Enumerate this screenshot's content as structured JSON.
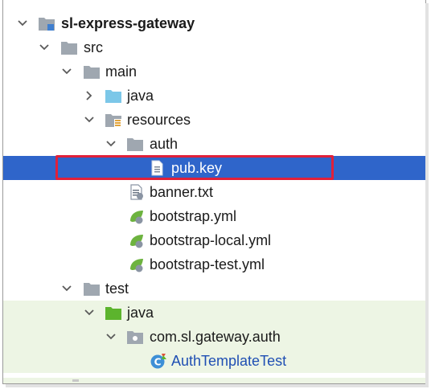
{
  "project_tree": {
    "items": [
      {
        "label": "sl-express-gateway",
        "icon": "module-folder-icon",
        "expanded": true
      },
      {
        "label": "src",
        "icon": "folder-icon",
        "expanded": true
      },
      {
        "label": "main",
        "icon": "folder-icon",
        "expanded": true
      },
      {
        "label": "java",
        "icon": "source-folder-icon",
        "expanded": false
      },
      {
        "label": "resources",
        "icon": "resources-folder-icon",
        "expanded": true
      },
      {
        "label": "auth",
        "icon": "folder-icon",
        "expanded": true
      },
      {
        "label": "pub.key",
        "icon": "text-file-icon",
        "selected": true
      },
      {
        "label": "banner.txt",
        "icon": "text-file-icon"
      },
      {
        "label": "bootstrap.yml",
        "icon": "spring-yml-icon"
      },
      {
        "label": "bootstrap-local.yml",
        "icon": "spring-yml-icon"
      },
      {
        "label": "bootstrap-test.yml",
        "icon": "spring-yml-icon"
      },
      {
        "label": "test",
        "icon": "folder-icon",
        "expanded": true
      },
      {
        "label": "java",
        "icon": "test-source-folder-icon",
        "expanded": true
      },
      {
        "label": "com.sl.gateway.auth",
        "icon": "package-icon",
        "expanded": true
      },
      {
        "label": "AuthTemplateTest",
        "icon": "java-class-icon"
      }
    ]
  },
  "colors": {
    "selection": "#2f65ca",
    "test_row_bg": "#edf5e4",
    "highlight_border": "#e0203a",
    "source_folder": "#7cc7e8",
    "test_folder": "#5cb42d",
    "class_label": "#1f4fb3"
  }
}
